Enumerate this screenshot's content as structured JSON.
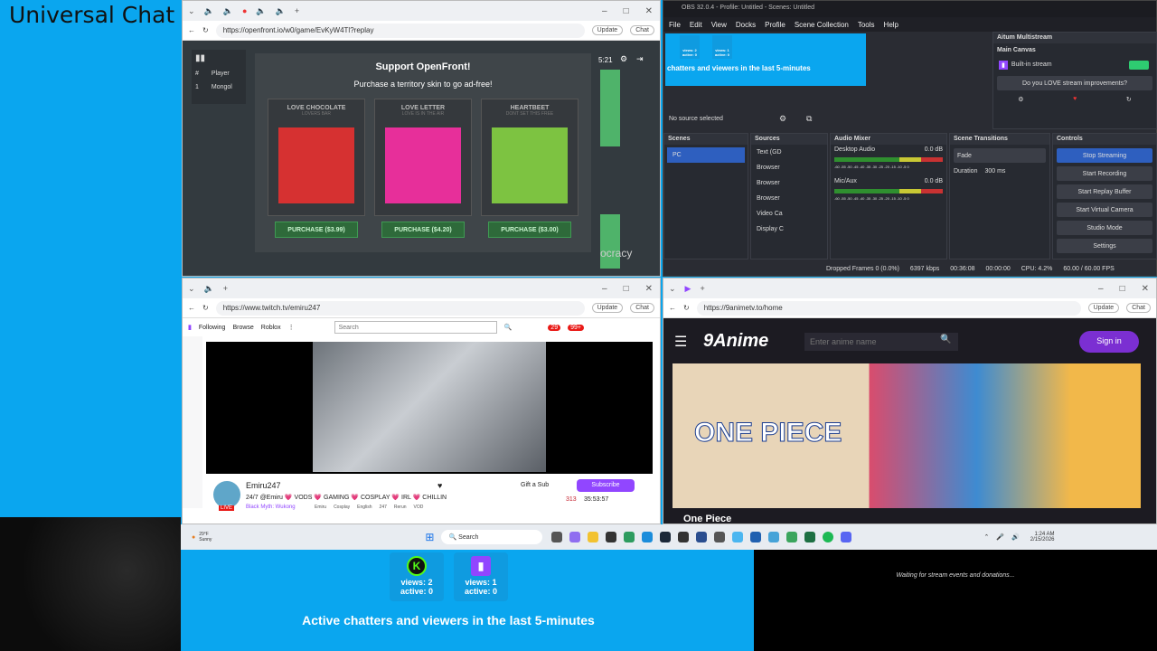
{
  "overlay": {
    "title": "Universal Chat"
  },
  "openfront": {
    "url": "https://openfront.io/w0/game/EvKyW4Tl?replay",
    "dialog_title": "Support OpenFront!",
    "dialog_sub": "Purchase a territory skin to go ad-free!",
    "timer": "5:21",
    "table_hdr": [
      "#",
      "Player"
    ],
    "row": [
      "1",
      "Mongol"
    ],
    "skins": [
      {
        "name": "LOVE CHOCOLATE",
        "tag": "LOVERS BAR",
        "price": "PURCHASE ($3.99)",
        "color": "#d63131"
      },
      {
        "name": "LOVE LETTER",
        "tag": "LOVE IS IN THE AIR",
        "price": "PURCHASE ($4.20)",
        "color": "#e72f9a"
      },
      {
        "name": "HEARTBEET",
        "tag": "DONT SET THIS FREE",
        "price": "PURCHASE ($3.00)",
        "color": "#7dc341"
      }
    ],
    "bg_word": "ocracy"
  },
  "obs": {
    "title": "OBS 32.0.4 - Profile: Untitled - Scenes: Untitled",
    "menu": [
      "File",
      "Edit",
      "View",
      "Docks",
      "Profile",
      "Scene Collection",
      "Tools",
      "Help"
    ],
    "preview_text": "chatters and viewers in the last 5-minutes",
    "no_source": "No source selected",
    "multistream": {
      "title": "Aitum Multistream",
      "canvas": "Main Canvas",
      "output": "Built-in stream",
      "question": "Do you LOVE stream improvements?"
    },
    "scenes": {
      "title": "Scenes",
      "items": [
        "PC"
      ]
    },
    "sources": {
      "title": "Sources",
      "items": [
        "Text (GD",
        "Browser",
        "Browser",
        "Browser",
        "Video Ca",
        "Display C"
      ]
    },
    "mixer": {
      "title": "Audio Mixer",
      "ch1": "Desktop Audio",
      "ch2": "Mic/Aux",
      "db": "0.0 dB",
      "scale": "-60 -55 -50 -45 -40 -35 -30 -25 -20 -15 -10 -5 0"
    },
    "transitions": {
      "title": "Scene Transitions",
      "type": "Fade",
      "duration_label": "Duration",
      "duration": "300 ms"
    },
    "controls": {
      "title": "Controls",
      "buttons": [
        "Stop Streaming",
        "Start Recording",
        "Start Replay Buffer",
        "Start Virtual Camera",
        "Studio Mode",
        "Settings"
      ]
    },
    "status": {
      "dropped": "Dropped Frames 0 (0.0%)",
      "kbps": "6397 kbps",
      "live": "00:36:08",
      "rec": "00:00:00",
      "cpu": "CPU: 4.2%",
      "fps": "60.00 / 60.00 FPS"
    },
    "counters": {
      "k": "views: 2 active: 0",
      "t": "views: 1 active: 0"
    }
  },
  "twitch": {
    "url": "https://www.twitch.tv/emiru247",
    "nav": [
      "Following",
      "Browse",
      "Roblox"
    ],
    "search_placeholder": "Search",
    "badges": [
      "29",
      "99+"
    ],
    "channel": "Emiru247",
    "stream_title": "24/7 @Emiru 💗 VODS 💗 GAMING 💗 COSPLAY 💗 IRL 💗 CHILLIN",
    "game": "Black Myth: Wukong",
    "tags": [
      "Emiru",
      "Cosplay",
      "English",
      "247",
      "Rerun",
      "VOD"
    ],
    "viewers": "313",
    "uptime": "35:53:57",
    "gift": "Gift a Sub",
    "subscribe": "Subscribe",
    "live": "LIVE"
  },
  "anime": {
    "url": "https://9animetv.to/home",
    "logo": "9Anime",
    "search_placeholder": "Enter anime name",
    "signin": "Sign in",
    "show": "One Piece",
    "banner_title": "ONE PIECE"
  },
  "taskbar": {
    "weather_temp": "29°F",
    "weather": "Sunny",
    "search": "Search",
    "time": "1:24 AM",
    "date": "2/15/2026"
  },
  "bottom": {
    "k_views": "views: 2",
    "k_active": "active: 0",
    "t_views": "views: 1",
    "t_active": "active: 0",
    "caption": "Active chatters and viewers in the last 5-minutes",
    "donations": "Waiting for stream events and donations..."
  },
  "chrome": {
    "update": "Update",
    "chat": "Chat"
  }
}
